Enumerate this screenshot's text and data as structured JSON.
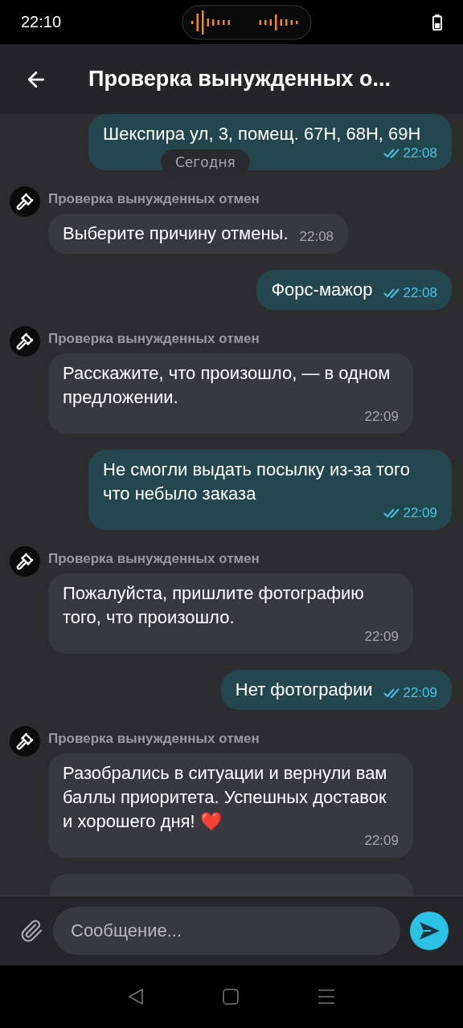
{
  "status_bar": {
    "time": "22:10"
  },
  "header": {
    "title": "Проверка вынужденных о..."
  },
  "date_badge": "Сегодня",
  "messages": [
    {
      "kind": "outgoing",
      "text": "Шекспира ул, 3, помещ. 67Н, 68Н, 69Н",
      "time": "22:08",
      "read": true
    },
    {
      "kind": "incoming",
      "sender": "Проверка вынужденных отмен",
      "text": "Выберите причину отмены.",
      "time": "22:08"
    },
    {
      "kind": "outgoing",
      "text": "Форс-мажор",
      "time": "22:08",
      "read": true
    },
    {
      "kind": "incoming",
      "sender": "Проверка вынужденных отмен",
      "text": "Расскажите, что произошло, — в одном предложении.",
      "time": "22:09"
    },
    {
      "kind": "outgoing",
      "text": "Не смогли выдать посылку из-за того что небыло заказа",
      "time": "22:09",
      "read": true
    },
    {
      "kind": "incoming",
      "sender": "Проверка вынужденных отмен",
      "text": "Пожалуйста, пришлите фотографию того, что произошло.",
      "time": "22:09"
    },
    {
      "kind": "outgoing",
      "text": "Нет фотографии",
      "time": "22:09",
      "read": true
    },
    {
      "kind": "incoming",
      "sender": "Проверка вынужденных отмен",
      "text": "Разобрались в ситуации и вернули вам баллы приоритета. Успешных доставок и хорошего дня! ❤️",
      "time": "22:09"
    },
    {
      "kind": "stub"
    }
  ],
  "composer": {
    "placeholder": "Сообщение..."
  }
}
